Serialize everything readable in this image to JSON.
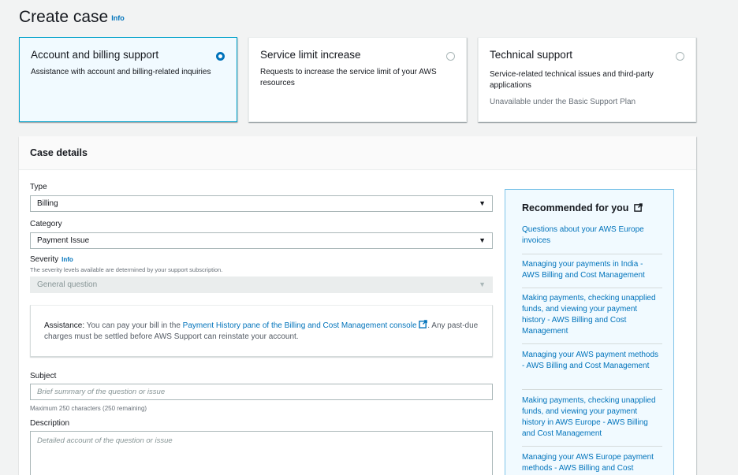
{
  "page": {
    "title": "Create case",
    "title_info": "Info"
  },
  "support_types": [
    {
      "title": "Account and billing support",
      "description": "Assistance with account and billing-related inquiries",
      "selected": true,
      "note": ""
    },
    {
      "title": "Service limit increase",
      "description": "Requests to increase the service limit of your AWS resources",
      "selected": false,
      "note": ""
    },
    {
      "title": "Technical support",
      "description": "Service-related technical issues and third-party applications",
      "selected": false,
      "note": "Unavailable under the Basic Support Plan"
    }
  ],
  "case_details": {
    "heading": "Case details",
    "type": {
      "label": "Type",
      "value": "Billing"
    },
    "category": {
      "label": "Category",
      "value": "Payment Issue"
    },
    "severity": {
      "label": "Severity",
      "info": "Info",
      "hint": "The severity levels available are determined by your support subscription.",
      "value": "General question"
    },
    "assistance": {
      "prefix": "Assistance:",
      "text_before": " You can pay your bill in the ",
      "link": "Payment History pane of the Billing and Cost Management console",
      "text_after": ". Any past-due charges must be settled before AWS Support can reinstate your account."
    },
    "subject": {
      "label": "Subject",
      "placeholder": "Brief summary of the question or issue",
      "hint": "Maximum 250 characters (250 remaining)"
    },
    "description": {
      "label": "Description",
      "placeholder": "Detailed account of the question or issue"
    }
  },
  "recommended": {
    "title": "Recommended for you",
    "items": [
      "Questions about your AWS Europe invoices",
      "Managing your payments in India - AWS Billing and Cost Management",
      "Making payments, checking unapplied funds, and viewing your payment history - AWS Billing and Cost Management",
      "Managing your AWS payment methods - AWS Billing and Cost Management",
      "Making payments, checking unapplied funds, and viewing your payment history in AWS Europe - AWS Billing and Cost Management",
      "Managing your AWS Europe payment methods - AWS Billing and Cost"
    ]
  },
  "colors": {
    "accent": "#0073bb",
    "selected_border": "#00a1c9",
    "selected_bg": "#f1faff"
  }
}
